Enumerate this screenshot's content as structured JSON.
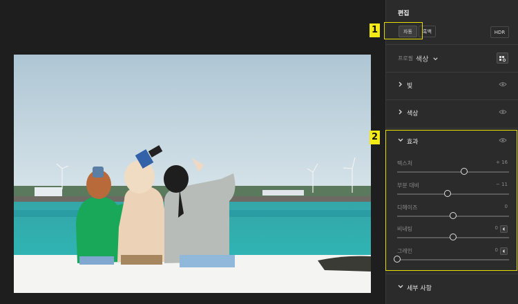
{
  "editor": {
    "title": "편집",
    "buttons": {
      "auto": "자동",
      "bw": "흑백",
      "hdr": "HDR"
    },
    "profile": {
      "label": "프로필",
      "value": "색상"
    }
  },
  "sections": {
    "light": "빛",
    "color": "색상",
    "effects": "효과",
    "detail": "세부 사항"
  },
  "effects_sliders": [
    {
      "name": "텍스처",
      "value": "+ 16",
      "level": 0.6
    },
    {
      "name": "부분 대비",
      "value": "− 11",
      "level": 0.45
    },
    {
      "name": "디헤이즈",
      "value": "0",
      "level": 0.5
    },
    {
      "name": "비네팅",
      "value": "0",
      "level": 0.5
    },
    {
      "name": "그레인",
      "value": "0",
      "level": 0.0
    }
  ],
  "callouts": {
    "one": "1",
    "two": "2"
  },
  "colors": {
    "callout": "#f3ea18",
    "panel": "#2b2b2b",
    "background": "#1e1e1e"
  },
  "icons": [
    "chevron-down-icon",
    "chevron-right-icon",
    "eye-icon",
    "profile-grid-icon",
    "chevron-left-icon"
  ]
}
